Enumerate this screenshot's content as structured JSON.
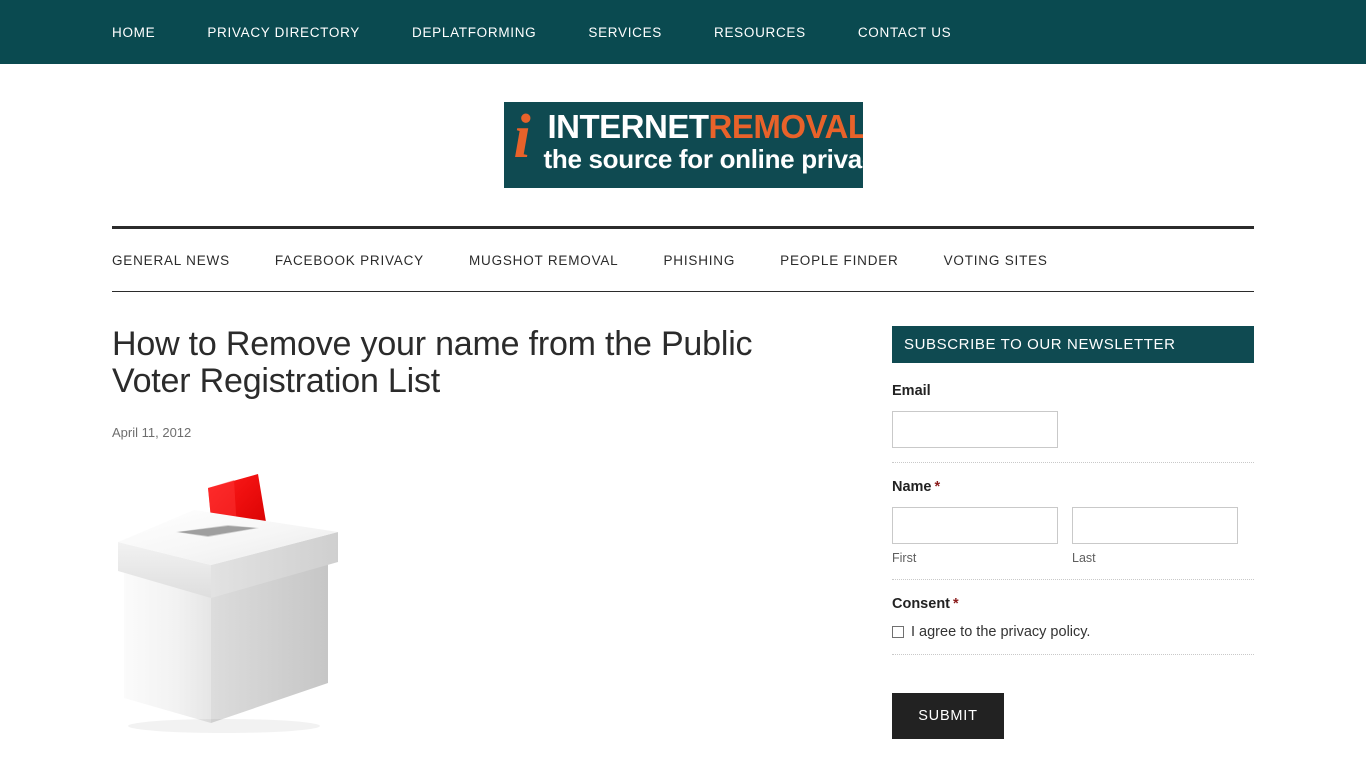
{
  "colors": {
    "brand_teal": "#0a4a50",
    "logo_teal": "#0f4a51",
    "brand_orange": "#e8622a",
    "ink": "#2b2b2b",
    "required_red": "#8a1c1c",
    "submit_dark": "#222222",
    "ballot_red": "#f01717"
  },
  "topnav": {
    "items": [
      {
        "label": "HOME"
      },
      {
        "label": "PRIVACY DIRECTORY"
      },
      {
        "label": "DEPLATFORMING"
      },
      {
        "label": "SERVICES"
      },
      {
        "label": "RESOURCES"
      },
      {
        "label": "CONTACT US"
      }
    ]
  },
  "logo": {
    "mark": "i",
    "word_white": "INTERNET",
    "word_orange": "REMOVAL",
    "tagline": "the source for online privacy"
  },
  "subnav": {
    "items": [
      {
        "label": "GENERAL NEWS"
      },
      {
        "label": "FACEBOOK PRIVACY"
      },
      {
        "label": "MUGSHOT REMOVAL"
      },
      {
        "label": "PHISHING"
      },
      {
        "label": "PEOPLE FINDER"
      },
      {
        "label": "VOTING SITES"
      }
    ]
  },
  "post": {
    "title": "How to Remove your name from the Public Voter Registration List",
    "date": "April 11, 2012",
    "image_alt": "ballot-box-illustration"
  },
  "newsletter": {
    "heading": "SUBSCRIBE TO OUR NEWSLETTER",
    "email": {
      "label": "Email",
      "value": "",
      "placeholder": ""
    },
    "name": {
      "label": "Name",
      "required_mark": "*",
      "first": {
        "value": "",
        "placeholder": "",
        "sub_label": "First"
      },
      "last": {
        "value": "",
        "placeholder": "",
        "sub_label": "Last"
      }
    },
    "consent": {
      "label": "Consent",
      "required_mark": "*",
      "checkbox_label": "I agree to the privacy policy.",
      "checked": false
    },
    "submit_label": "SUBMIT"
  }
}
